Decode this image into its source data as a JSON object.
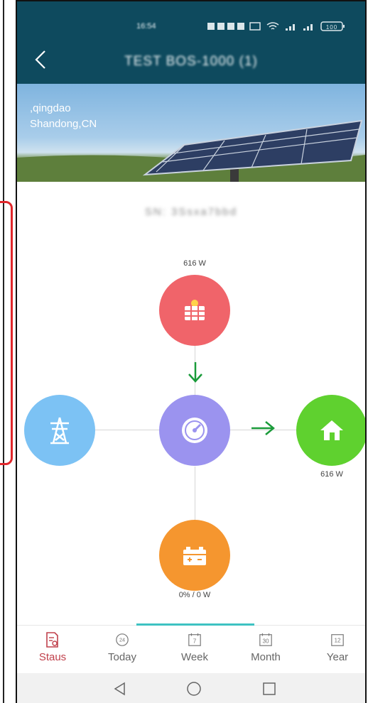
{
  "status_bar": {
    "time": "16:54",
    "battery": "100"
  },
  "header": {
    "title": "TEST BOS-1000 (1)"
  },
  "banner": {
    "city_line1": ",qingdao",
    "city_line2": "Shandong,CN"
  },
  "device": {
    "serial": "SN: 3Ssxa7bbd"
  },
  "flow": {
    "solar_power": "616 W",
    "load_power": "616 W",
    "battery_status": "0% / 0 W"
  },
  "tabs": [
    {
      "label": "Staus",
      "icon": "status-report-icon",
      "active": true
    },
    {
      "label": "Today",
      "icon": "24h-clock-icon",
      "active": false
    },
    {
      "label": "Week",
      "icon": "calendar-7-icon",
      "active": false
    },
    {
      "label": "Month",
      "icon": "calendar-30-icon",
      "active": false
    },
    {
      "label": "Year",
      "icon": "calendar-12-icon",
      "active": false
    }
  ],
  "tab_icon_text": {
    "today": "24",
    "week": "7",
    "month": "30",
    "year": "12"
  },
  "colors": {
    "header_bg": "#0e4a5e",
    "solar": "#f0646a",
    "grid": "#7cc2f4",
    "inverter": "#9b93ef",
    "load": "#5fd12f",
    "battery": "#f5962f",
    "flow_arrow": "#1a9b3a",
    "active_tab": "#c0404b",
    "tab_indicator": "#3ec2c2"
  }
}
